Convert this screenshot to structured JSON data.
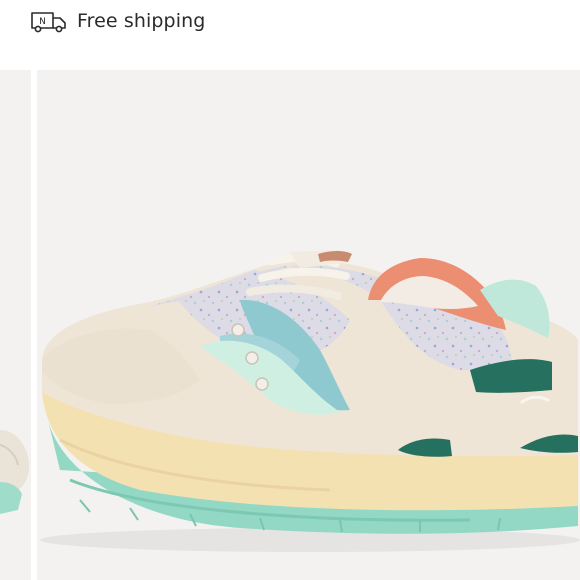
{
  "shipping": {
    "icon": "delivery-truck-icon",
    "badge_letter": "N",
    "label": "Free shipping"
  },
  "gallery": {
    "background": "#f3f2f1",
    "main_image": "sneaker-product-photo",
    "prev_image": "sneaker-thumbnail-partial",
    "colors": {
      "cream": "#efe6d6",
      "sole": "#f3dfae",
      "outsole": "#8fd6c3",
      "blue_suede": "#8fc9cf",
      "mint": "#cbeee2",
      "teal": "#23705f",
      "coral": "#e98c70",
      "speckle_mesh": "#d9d9e4"
    }
  }
}
